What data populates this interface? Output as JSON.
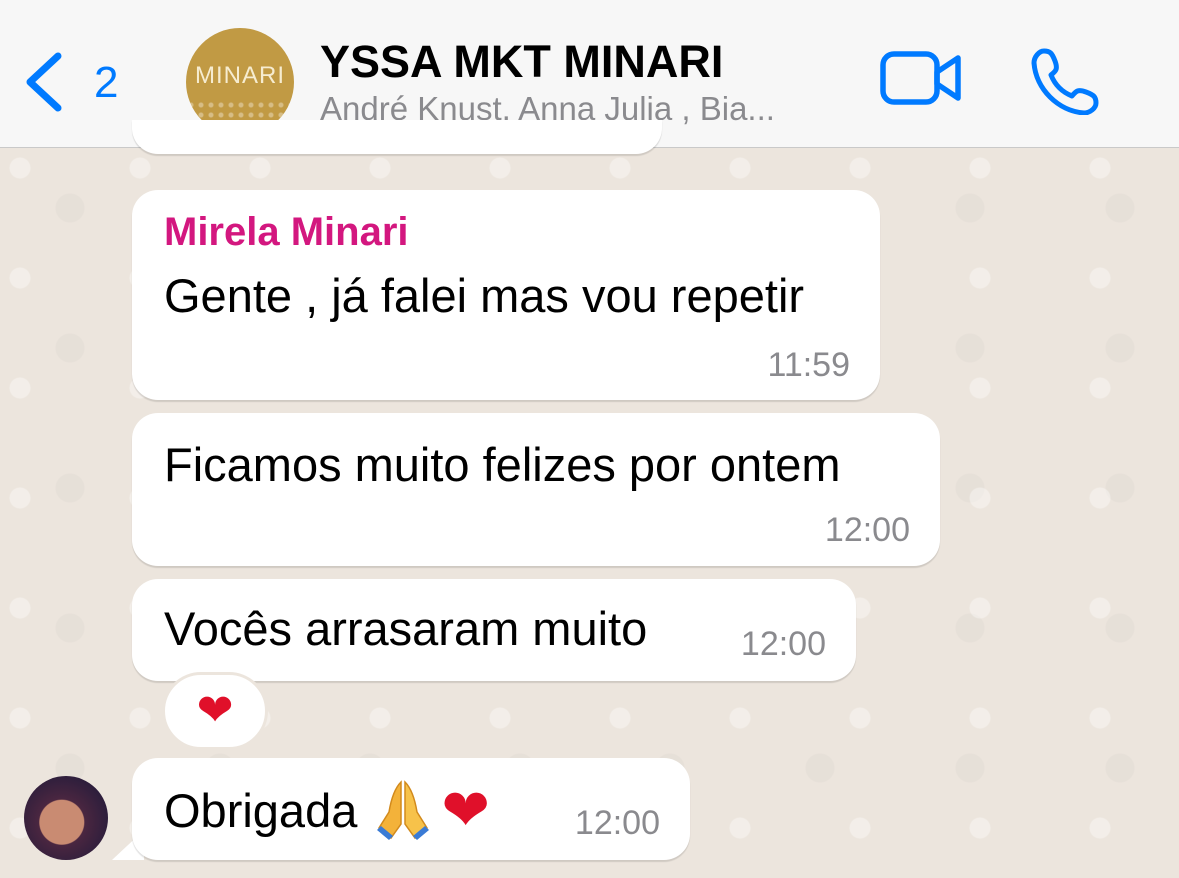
{
  "header": {
    "back_count": "2",
    "group_logo_text": "MINARI",
    "title": "YSSA MKT MINARI",
    "subtitle": "André Knust, Anna Julia , Bia..."
  },
  "messages": [
    {
      "sender": "Mirela Minari",
      "text": "Gente , já falei mas vou repetir",
      "time": "11:59"
    },
    {
      "text": "Ficamos muito felizes por ontem",
      "time": "12:00"
    },
    {
      "text": "Vocês arrasaram muito",
      "time": "12:00",
      "reaction": "❤"
    },
    {
      "text": "Obrigada",
      "emoji": "❤",
      "time": "12:00"
    }
  ],
  "colors": {
    "accent": "#007aff",
    "sender": "#d3177f",
    "background": "#ece5dd"
  },
  "icons": [
    "chevron-left-icon",
    "video-camera-icon",
    "phone-icon",
    "prayer-hands-emoji",
    "red-heart-emoji"
  ]
}
